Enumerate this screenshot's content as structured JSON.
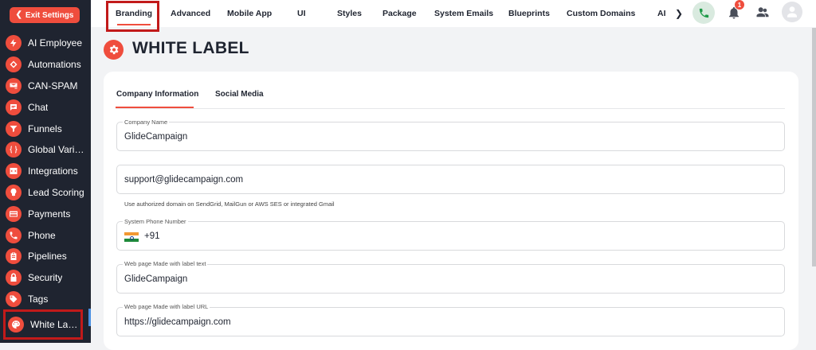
{
  "sidebar": {
    "exit_label": "Exit Settings",
    "items": [
      {
        "label": "AI Employee",
        "icon": "bolt-icon"
      },
      {
        "label": "Automations",
        "icon": "flow-icon"
      },
      {
        "label": "CAN-SPAM",
        "icon": "mail-block-icon"
      },
      {
        "label": "Chat",
        "icon": "chat-icon"
      },
      {
        "label": "Funnels",
        "icon": "funnel-icon"
      },
      {
        "label": "Global Variables",
        "icon": "braces-icon"
      },
      {
        "label": "Integrations",
        "icon": "code-icon"
      },
      {
        "label": "Lead Scoring",
        "icon": "score-icon"
      },
      {
        "label": "Payments",
        "icon": "card-icon"
      },
      {
        "label": "Phone",
        "icon": "phone-icon"
      },
      {
        "label": "Pipelines",
        "icon": "clipboard-icon"
      },
      {
        "label": "Security",
        "icon": "lock-icon"
      },
      {
        "label": "Tags",
        "icon": "tag-icon"
      },
      {
        "label": "White Label",
        "icon": "palette-icon"
      }
    ]
  },
  "topbar": {
    "tabs": [
      "Branding",
      "Advanced",
      "Mobile App",
      "UI",
      "Styles",
      "Package",
      "System Emails",
      "Blueprints",
      "Custom Domains",
      "AI"
    ],
    "active_tab": "Branding",
    "notification_count": "1"
  },
  "page": {
    "title": "WHITE LABEL",
    "subtabs": [
      "Company Information",
      "Social Media"
    ],
    "active_subtab": "Company Information"
  },
  "form": {
    "company_name_label": "Company Name",
    "company_name_value": "GlideCampaign",
    "email_value": "support@glidecampaign.com",
    "email_hint": "Use authorized domain on SendGrid, MailGun or AWS SES or integrated Gmail",
    "phone_label": "System Phone Number",
    "phone_code": "+91",
    "made_with_text_label": "Web page Made with label text",
    "made_with_text_value": "GlideCampaign",
    "made_with_url_label": "Web page Made with label URL",
    "made_with_url_value": "https://glidecampaign.com"
  },
  "colors": {
    "accent": "#ef4d3d",
    "sidebar_bg": "#1f2430",
    "highlight_box": "#c21a1a"
  }
}
